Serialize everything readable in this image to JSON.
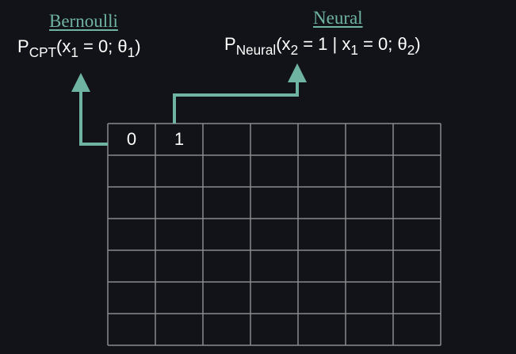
{
  "bernoulli": {
    "title": "Bernoulli",
    "formula": {
      "p": "P",
      "p_sub": "CPT",
      "open": "(x",
      "x_sub": "1",
      "rest": " = 0; θ",
      "theta_sub": "1",
      "close": ")"
    }
  },
  "neural": {
    "title": "Neural",
    "formula": {
      "p": "P",
      "p_sub": "Neural",
      "open": "(x",
      "x2_sub": "2",
      "mid": " = 1 | x",
      "x1_sub": "1",
      "rest": " = 0; θ",
      "theta_sub": "2",
      "close": ")"
    }
  },
  "grid": {
    "rows": 7,
    "cols": 7,
    "cells": [
      "0",
      "1"
    ]
  },
  "colors": {
    "background": "#121318",
    "accent": "#6fb3a3",
    "grid_line": "#8a8a8a",
    "text": "#ffffff"
  }
}
